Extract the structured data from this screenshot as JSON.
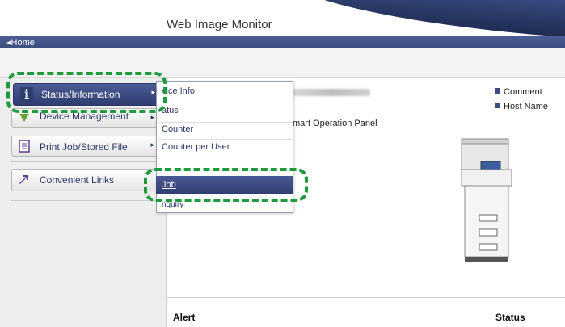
{
  "header": {
    "title": "Web Image Monitor",
    "home_link": "◂Home"
  },
  "sidebar": {
    "items": [
      {
        "label": "Status/Information",
        "icon": "info-icon"
      },
      {
        "label": "Device Management",
        "icon": "device-management-icon"
      },
      {
        "label": "Print Job/Stored File",
        "icon": "document-icon"
      },
      {
        "label": "Convenient Links",
        "icon": "arrow-link-icon"
      }
    ]
  },
  "dropdown": {
    "items": [
      {
        "label": "vice Info"
      },
      {
        "label": "atus"
      },
      {
        "label": "Counter"
      },
      {
        "label": "Counter per User"
      },
      {
        "label": "Job"
      },
      {
        "label": "nquiry"
      }
    ],
    "selected": "Job"
  },
  "main": {
    "smart_panel": "mart Operation Panel",
    "legend": [
      {
        "label": "Comment"
      },
      {
        "label": "Host Name"
      }
    ],
    "alert_header": "Alert",
    "status_header": "Status"
  },
  "colors": {
    "accent": "#3c4a82",
    "annotation": "#1f9a3c"
  }
}
